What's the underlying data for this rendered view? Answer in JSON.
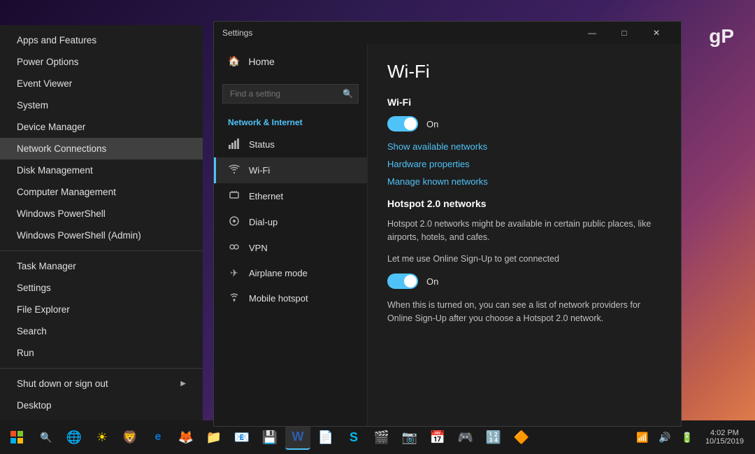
{
  "desktop": {
    "gp_logo": "gP"
  },
  "context_menu": {
    "items": [
      {
        "id": "apps-features",
        "label": "Apps and Features",
        "has_separator_after": false
      },
      {
        "id": "power-options",
        "label": "Power Options",
        "has_separator_after": false
      },
      {
        "id": "event-viewer",
        "label": "Event Viewer",
        "has_separator_after": false
      },
      {
        "id": "system",
        "label": "System",
        "has_separator_after": false
      },
      {
        "id": "device-manager",
        "label": "Device Manager",
        "has_separator_after": false
      },
      {
        "id": "network-connections",
        "label": "Network Connections",
        "highlighted": true,
        "has_separator_after": false
      },
      {
        "id": "disk-management",
        "label": "Disk Management",
        "has_separator_after": false
      },
      {
        "id": "computer-management",
        "label": "Computer Management",
        "has_separator_after": false
      },
      {
        "id": "windows-powershell",
        "label": "Windows PowerShell",
        "has_separator_after": false
      },
      {
        "id": "windows-powershell-admin",
        "label": "Windows PowerShell (Admin)",
        "has_separator_after": true
      },
      {
        "id": "task-manager",
        "label": "Task Manager",
        "has_separator_after": false
      },
      {
        "id": "settings",
        "label": "Settings",
        "has_separator_after": false
      },
      {
        "id": "file-explorer",
        "label": "File Explorer",
        "has_separator_after": false
      },
      {
        "id": "search",
        "label": "Search",
        "has_separator_after": false
      },
      {
        "id": "run",
        "label": "Run",
        "has_separator_after": true
      },
      {
        "id": "shut-down-sign-out",
        "label": "Shut down or sign out",
        "has_arrow": true,
        "has_separator_after": false
      },
      {
        "id": "desktop",
        "label": "Desktop",
        "has_separator_after": false
      }
    ]
  },
  "settings_window": {
    "title": "Settings",
    "window_controls": {
      "minimize": "—",
      "maximize": "□",
      "close": "✕"
    },
    "nav": {
      "home_label": "Home",
      "search_placeholder": "Find a setting",
      "section_title": "Network & Internet",
      "items": [
        {
          "id": "status",
          "label": "Status",
          "icon": "📶"
        },
        {
          "id": "wifi",
          "label": "Wi-Fi",
          "icon": "📶",
          "active": true
        },
        {
          "id": "ethernet",
          "label": "Ethernet",
          "icon": "🖥"
        },
        {
          "id": "dialup",
          "label": "Dial-up",
          "icon": "📞"
        },
        {
          "id": "vpn",
          "label": "VPN",
          "icon": "🔗"
        },
        {
          "id": "airplane",
          "label": "Airplane mode",
          "icon": "✈"
        },
        {
          "id": "mobile-hotspot",
          "label": "Mobile hotspot",
          "icon": "📡"
        }
      ]
    },
    "content": {
      "page_title": "Wi-Fi",
      "wifi_section": {
        "title": "Wi-Fi",
        "toggle_on_label": "On",
        "show_networks_link": "Show available networks",
        "hardware_properties_link": "Hardware properties",
        "manage_known_link": "Manage known networks"
      },
      "hotspot_section": {
        "title": "Hotspot 2.0 networks",
        "description1": "Hotspot 2.0 networks might be available in certain public places, like airports, hotels, and cafes.",
        "description2": "Let me use Online Sign-Up to get connected",
        "toggle_on_label": "On",
        "description3": "When this is turned on, you can see a list of network providers for Online Sign-Up after you choose a Hotspot 2.0 network."
      }
    }
  },
  "taskbar": {
    "start_icon": "⊞",
    "search_icon": "🔍",
    "time": "4:02 PM",
    "date": "10/15/2019",
    "icons": [
      {
        "id": "chrome",
        "char": "🌐"
      },
      {
        "id": "brightness",
        "char": "☀"
      },
      {
        "id": "brave",
        "char": "🦁"
      },
      {
        "id": "edge",
        "char": "e"
      },
      {
        "id": "firefox",
        "char": "🦊"
      },
      {
        "id": "file-manager",
        "char": "📁"
      },
      {
        "id": "mail",
        "char": "📧"
      },
      {
        "id": "network-drive",
        "char": "💾"
      },
      {
        "id": "word",
        "char": "W"
      },
      {
        "id": "pdf",
        "char": "📄"
      },
      {
        "id": "store",
        "char": "S"
      },
      {
        "id": "media",
        "char": "🎬"
      },
      {
        "id": "camera",
        "char": "📷"
      },
      {
        "id": "calendar",
        "char": "📅"
      },
      {
        "id": "game",
        "char": "🎮"
      },
      {
        "id": "calculator",
        "char": "🔢"
      },
      {
        "id": "vlc",
        "char": "🔶"
      }
    ],
    "tray_icons": [
      {
        "id": "network",
        "char": "📶"
      },
      {
        "id": "volume",
        "char": "🔊"
      },
      {
        "id": "battery",
        "char": "🔋"
      }
    ]
  }
}
